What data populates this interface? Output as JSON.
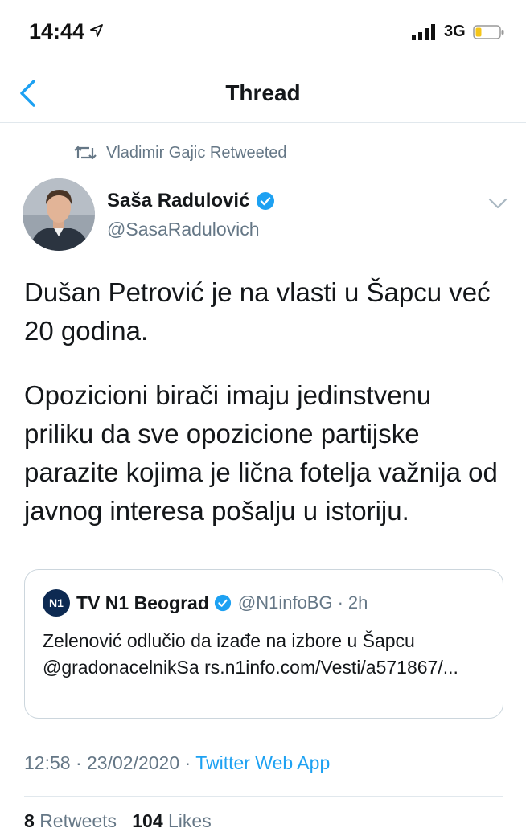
{
  "status_bar": {
    "time": "14:44",
    "network": "3G"
  },
  "nav": {
    "title": "Thread"
  },
  "retweet": {
    "text": "Vladimir Gajic Retweeted"
  },
  "author": {
    "name": "Saša Radulović",
    "handle": "@SasaRadulovich"
  },
  "tweet": {
    "paragraph1": "Dušan Petrović je na vlasti u Šapcu već 20 godina.",
    "paragraph2": "Opozicioni birači imaju jedinstvenu priliku da sve opozicione partijske parazite kojima je lična fotelja važnija od javnog interesa pošalju u istoriju."
  },
  "quoted": {
    "logo": "N1",
    "name": "TV N1 Beograd",
    "handle": "@N1infoBG",
    "separator": "·",
    "time": "2h",
    "text": "Zelenović odlučio da izađe na izbore u Šapcu @gradonacelnikSa rs.n1info.com/Vesti/a571867/..."
  },
  "meta": {
    "time": "12:58",
    "separator": "·",
    "date": "23/02/2020",
    "app": "Twitter Web App"
  },
  "stats": {
    "retweets_count": "8",
    "retweets_label": "Retweets",
    "likes_count": "104",
    "likes_label": "Likes"
  },
  "colors": {
    "accent": "#1da1f2",
    "text": "#14171a",
    "secondary": "#657786",
    "border": "#ccd6dd"
  },
  "icons": [
    "location-arrow-icon",
    "signal-icon",
    "battery-icon",
    "back-chevron-icon",
    "retweet-icon",
    "verified-icon",
    "chevron-down-icon"
  ]
}
